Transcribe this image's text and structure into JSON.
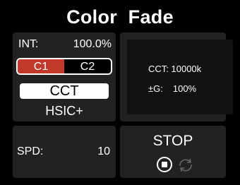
{
  "title": "Color  Fade",
  "intensity": {
    "label": "INT:",
    "value": "100.0%"
  },
  "channels": {
    "items": [
      {
        "label": "C1",
        "active": true
      },
      {
        "label": "C2",
        "active": false
      }
    ]
  },
  "mode": {
    "selected": "CCT",
    "other": "HSIC+"
  },
  "cct_panel": {
    "cct": "CCT: 10000k",
    "g_label": "±G:",
    "g_value": "100%"
  },
  "speed": {
    "label": "SPD:",
    "value": "10"
  },
  "playback": {
    "label": "STOP",
    "stop_icon": "stop-icon",
    "loop_icon": "loop-icon"
  },
  "colors": {
    "active_channel": "#c0392b",
    "panel": "#222222",
    "background": "#000000"
  }
}
